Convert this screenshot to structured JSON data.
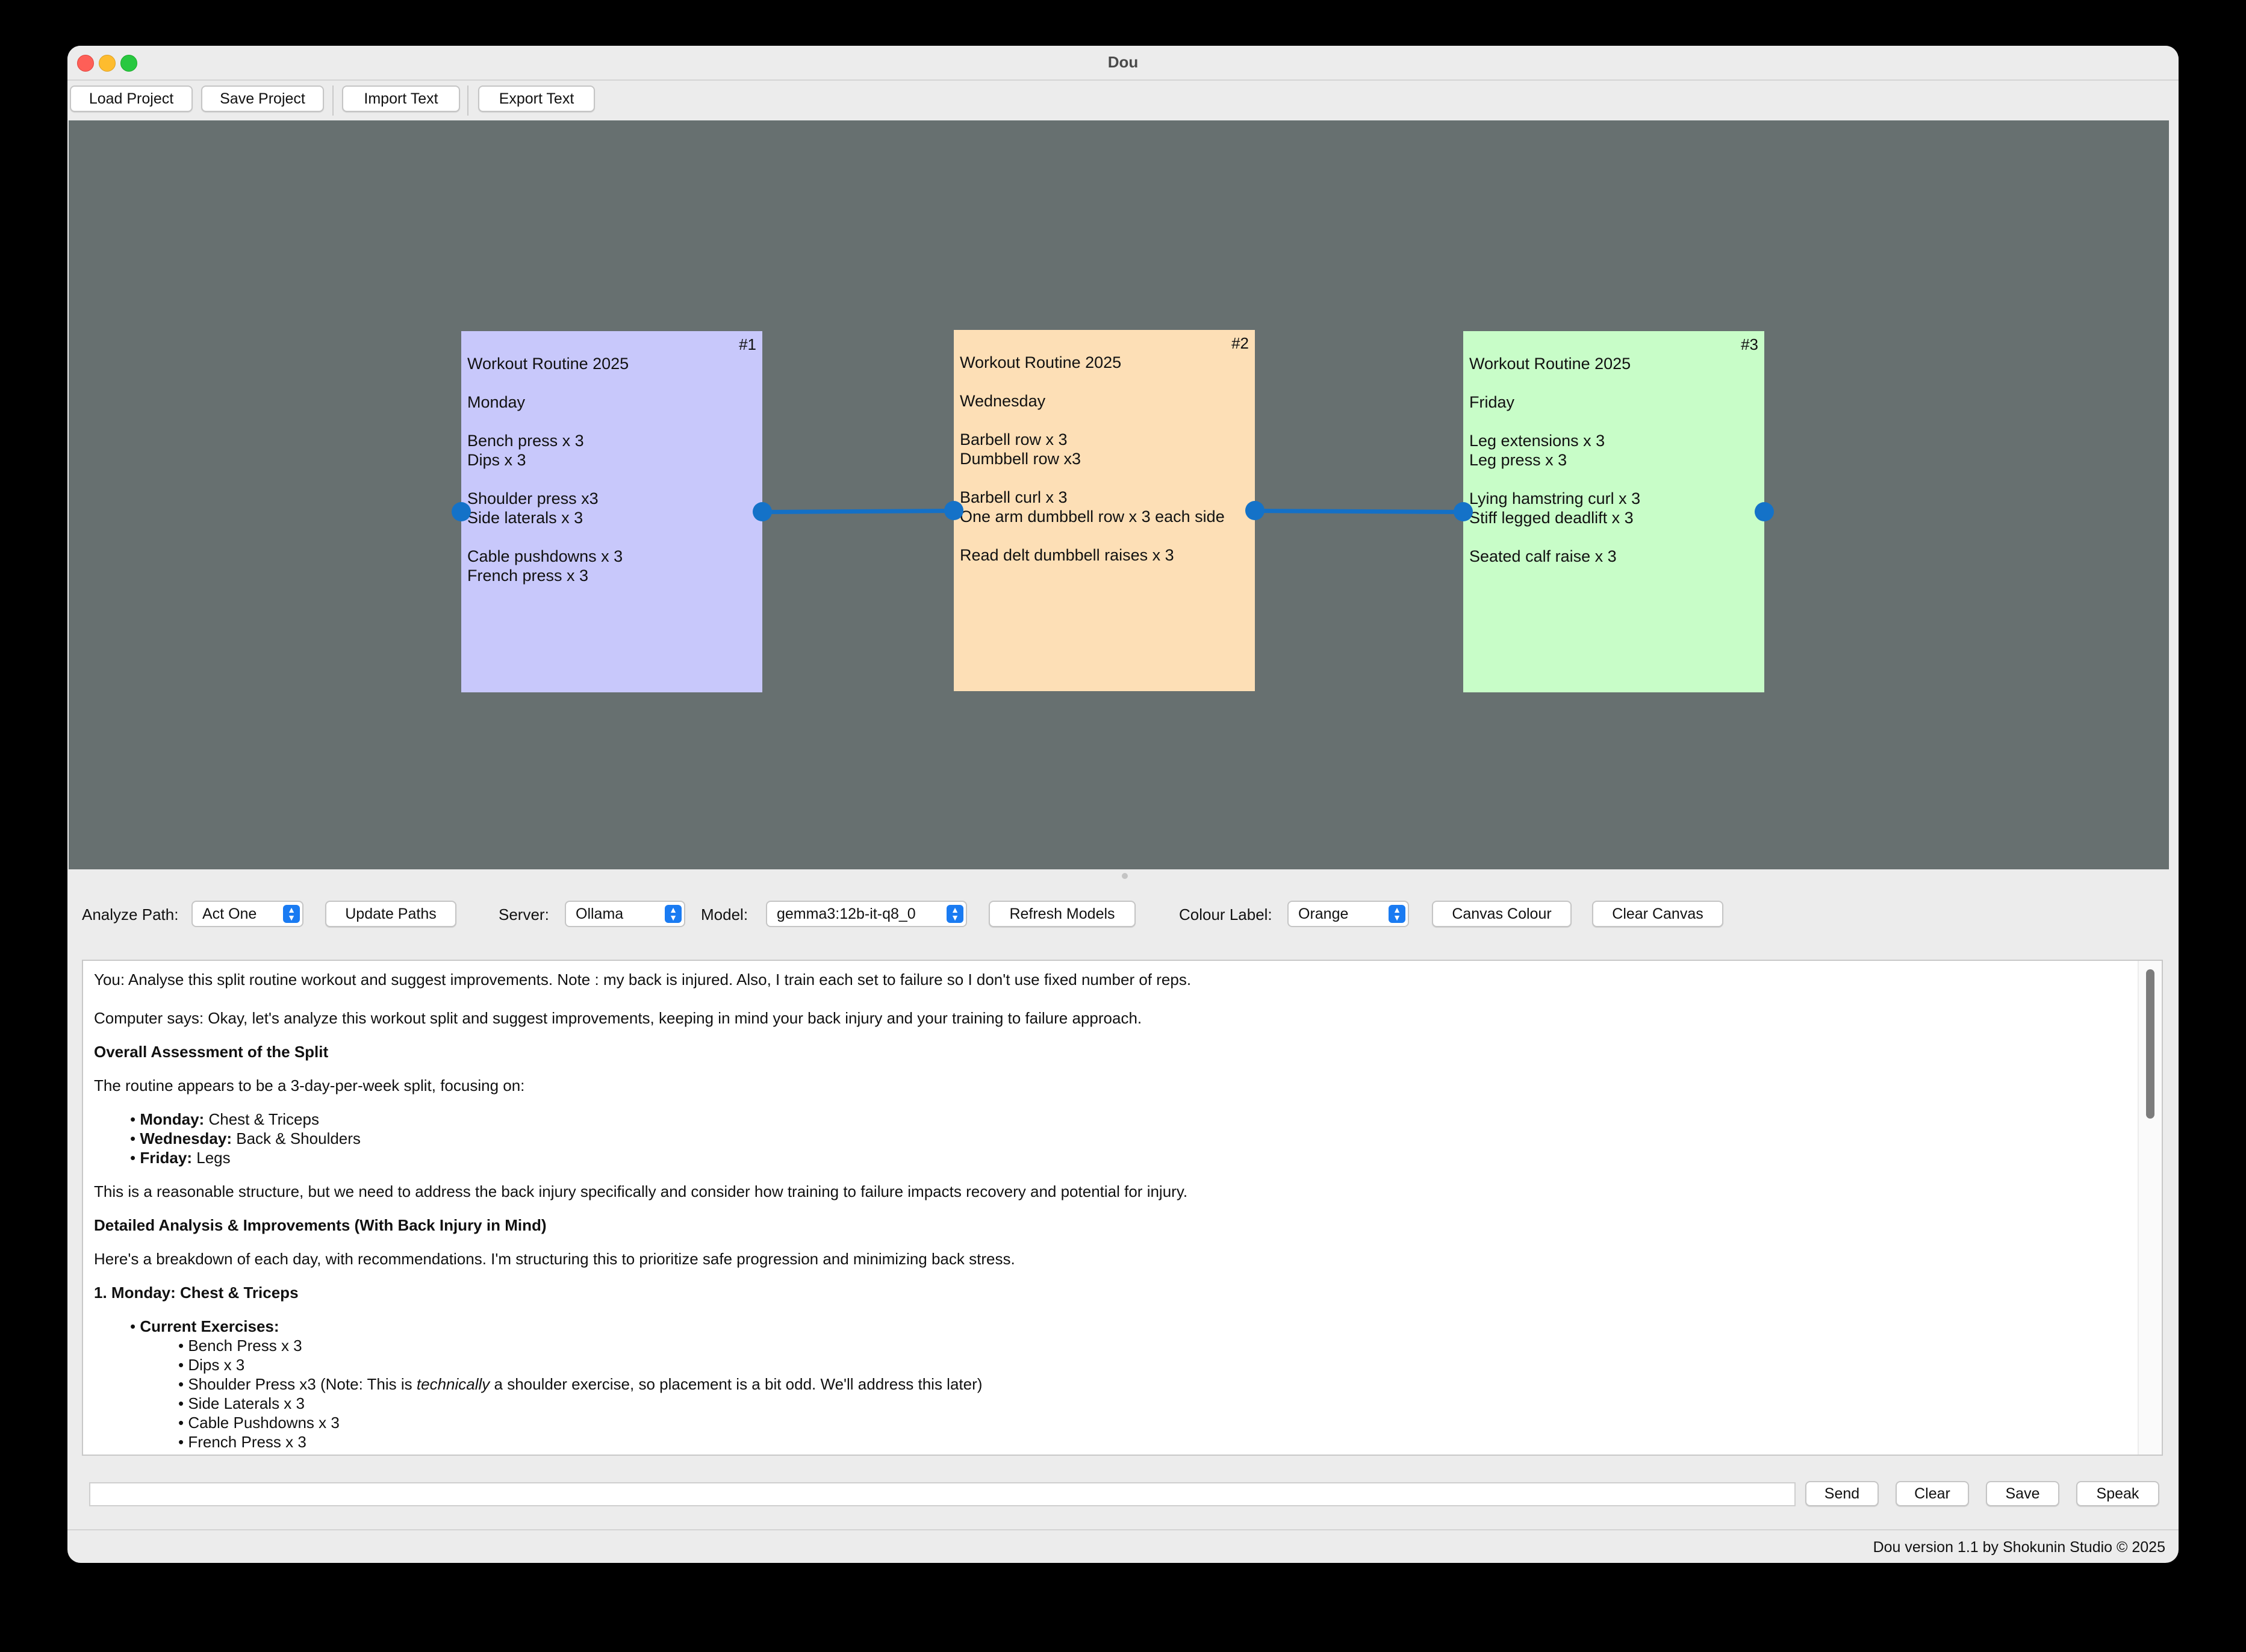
{
  "window": {
    "title": "Dou"
  },
  "toolbar": {
    "load_project": "Load Project",
    "save_project": "Save Project",
    "import_text": "Import Text",
    "export_text": "Export Text"
  },
  "canvas": {
    "background": "#677070",
    "notes": [
      {
        "id": "#1",
        "color": "#c8c8fb",
        "lines": [
          "Workout Routine 2025",
          "",
          "Monday",
          "",
          "Bench press x 3",
          "Dips x 3",
          "",
          "Shoulder press x3",
          "Side laterals x 3",
          "",
          "Cable pushdowns x 3",
          "French press x 3"
        ]
      },
      {
        "id": "#2",
        "color": "#fddfb6",
        "lines": [
          "Workout Routine 2025",
          "",
          "Wednesday",
          "",
          "Barbell row x 3",
          "Dumbbell row x3",
          "",
          "Barbell curl x 3",
          "One arm dumbbell row x 3 each side",
          "",
          "Read delt dumbbell raises x 3"
        ]
      },
      {
        "id": "#3",
        "color": "#c8fdc8",
        "lines": [
          "Workout Routine 2025",
          "",
          "Friday",
          "",
          "Leg extensions x 3",
          "Leg press x 3",
          "",
          "Lying hamstring curl x 3",
          "Stiff legged deadlift x 3",
          "",
          "Seated calf raise x 3"
        ]
      }
    ],
    "connector_color": "#1470c6"
  },
  "controls": {
    "analyze_path_label": "Analyze Path:",
    "analyze_path_value": "Act One",
    "update_paths": "Update Paths",
    "server_label": "Server:",
    "server_value": "Ollama",
    "model_label": "Model:",
    "model_value": "gemma3:12b-it-q8_0",
    "refresh_models": "Refresh Models",
    "colour_label_label": "Colour Label:",
    "colour_label_value": "Orange",
    "canvas_colour": "Canvas Colour",
    "clear_canvas": "Clear Canvas"
  },
  "output": {
    "user_msg": "You: Analyse this split routine workout and suggest improvements. Note : my back is injured. Also, I train each set to failure so I don't use fixed number of reps.",
    "reply_intro": "Computer says: Okay, let's analyze this workout split and suggest improvements, keeping in mind your back injury and your training to failure approach.",
    "h_overall": "Overall Assessment of the Split",
    "p_routine": "The routine appears to be a 3-day-per-week split, focusing on:",
    "days": [
      {
        "day": "Monday:",
        "focus": "Chest & Triceps"
      },
      {
        "day": "Wednesday:",
        "focus": "Back & Shoulders"
      },
      {
        "day": "Friday:",
        "focus": "Legs"
      }
    ],
    "p_reasonable": "This is a reasonable structure, but we need to address the back injury specifically and consider how training to failure impacts recovery and potential for injury.",
    "h_detailed": "Detailed Analysis & Improvements (With Back Injury in Mind)",
    "p_breakdown": "Here's a breakdown of each day, with recommendations. I'm structuring this to prioritize safe progression and minimizing back stress.",
    "h_monday": "1. Monday: Chest & Triceps",
    "current_exercises": "Current Exercises:",
    "exercises": [
      "Bench Press x 3",
      "Dips x 3"
    ],
    "shoulder_pre": "Shoulder Press x3 (Note: This is ",
    "shoulder_em": "technically",
    "shoulder_post": " a shoulder exercise, so placement is a bit odd. We'll address this later)",
    "exercises_after": [
      "Side Laterals x 3",
      "Cable Pushdowns x 3",
      "French Press x 3"
    ]
  },
  "bottom": {
    "send": "Send",
    "clear": "Clear",
    "save": "Save",
    "speak": "Speak"
  },
  "status": "Dou version 1.1 by Shokunin Studio © 2025"
}
